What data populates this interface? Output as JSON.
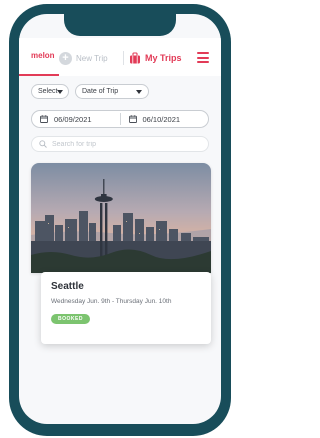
{
  "header": {
    "brand": "melon",
    "new_trip_label": "New Trip",
    "my_trips_label": "My Trips",
    "icons": {
      "new_trip": "plus-circle-icon",
      "my_trips": "luggage-icon",
      "menu": "hamburger-icon"
    }
  },
  "filters": {
    "select_label": "Select",
    "date_of_trip_label": "Date of Trip",
    "start_date": "06/09/2021",
    "end_date": "06/10/2021",
    "search_placeholder": "Search for trip"
  },
  "trips": [
    {
      "city": "Seattle",
      "dates": "Wednesday Jun. 9th - Thursday Jun. 10th",
      "status": "BOOKED",
      "image": "seattle-skyline-photo"
    }
  ],
  "colors": {
    "accent": "#e23b57",
    "frame": "#184d5a",
    "booked": "#7cc46f"
  }
}
